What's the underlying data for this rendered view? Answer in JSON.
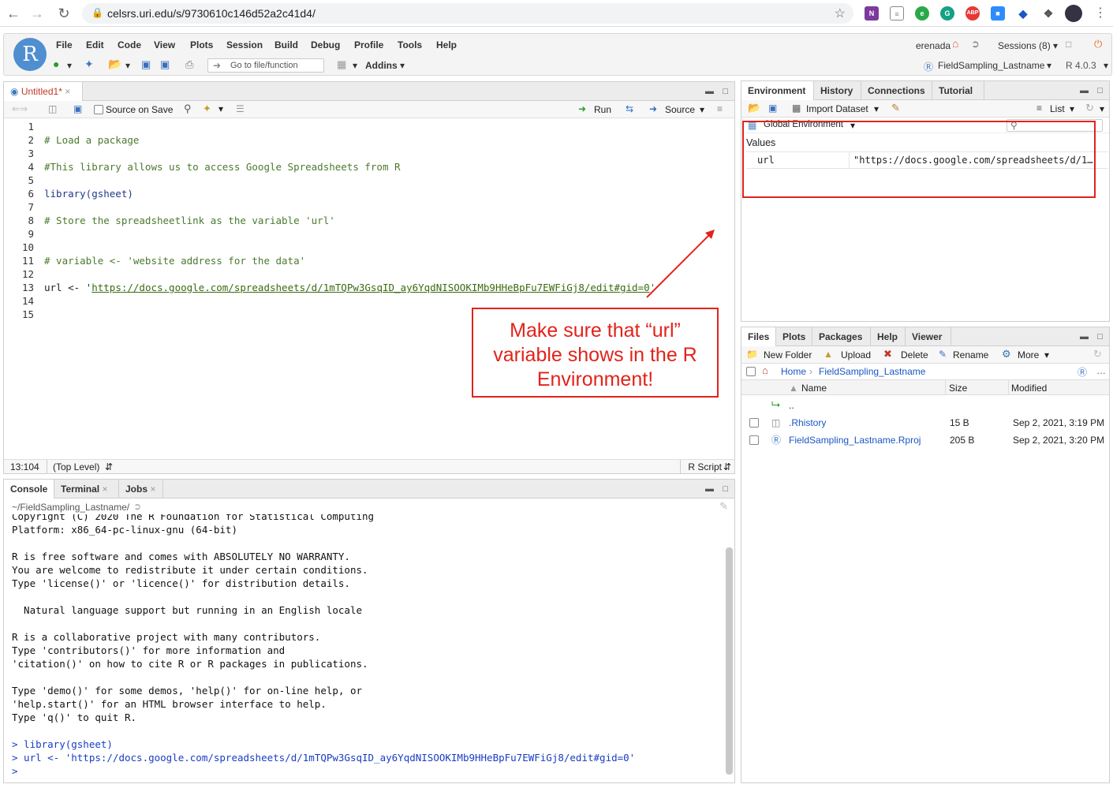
{
  "browser": {
    "url": "celsrs.uri.edu/s/9730610c146d52a2c41d4/",
    "extensions": [
      "onenote-icon",
      "doc-icon",
      "evernote-icon",
      "grammarly-icon",
      "adblock-icon",
      "zoom-icon",
      "graduation-icon",
      "puzzle-icon",
      "profile-icon"
    ]
  },
  "menu": {
    "items": [
      "File",
      "Edit",
      "Code",
      "View",
      "Plots",
      "Session",
      "Build",
      "Debug",
      "Profile",
      "Tools",
      "Help"
    ],
    "go_to_placeholder": "Go to file/function",
    "addins": "Addins",
    "user": "erenada",
    "sessions": "Sessions (8)",
    "project": "FieldSampling_Lastname",
    "r_version": "R 4.0.3"
  },
  "editor": {
    "tab": "Untitled1*",
    "source_on_save": "Source on Save",
    "run": "Run",
    "source": "Source",
    "lines": [
      {
        "n": "1",
        "t": "",
        "cls": ""
      },
      {
        "n": "2",
        "t": "# Load a package",
        "cls": "cmt"
      },
      {
        "n": "3",
        "t": "",
        "cls": ""
      },
      {
        "n": "4",
        "t": "#This library allows us to access Google Spreadsheets from R",
        "cls": "cmt"
      },
      {
        "n": "5",
        "t": "",
        "cls": ""
      },
      {
        "n": "6",
        "t": "library(gsheet)",
        "cls": "fn"
      },
      {
        "n": "7",
        "t": "",
        "cls": ""
      },
      {
        "n": "8",
        "t": "# Store the spreadsheetlink as the variable 'url'",
        "cls": "cmt"
      },
      {
        "n": "9",
        "t": "",
        "cls": ""
      },
      {
        "n": "10",
        "t": "",
        "cls": ""
      },
      {
        "n": "11",
        "t": "# variable <- 'website address for the data'",
        "cls": "cmt"
      },
      {
        "n": "12",
        "t": "",
        "cls": ""
      },
      {
        "n": "13",
        "t": "url <- 'https://docs.google.com/spreadsheets/d/1mTQPw3GsqID_ay6YqdNISOOKIMb9HHeBpFu7EWFiGj8/edit#gid=0'",
        "cls": "url"
      },
      {
        "n": "14",
        "t": "",
        "cls": ""
      },
      {
        "n": "15",
        "t": "",
        "cls": ""
      }
    ],
    "url_prefix": "url <- '",
    "url_link": "https://docs.google.com/spreadsheets/d/1mTQPw3GsqID_ay6YqdNISOOKIMb9HHeBpFu7EWFiGj8/edit#gid=0",
    "url_suffix": "'",
    "status_pos": "13:104",
    "status_scope": "(Top Level)",
    "status_type": "R Script"
  },
  "annotation": {
    "line1": "Make sure that “url”",
    "line2": "variable shows in the R",
    "line3": "Environment!"
  },
  "console": {
    "tabs": [
      "Console",
      "Terminal",
      "Jobs"
    ],
    "path": "~/FieldSampling_Lastname/",
    "lines": [
      "Copyright (C) 2020 The R Foundation for Statistical Computing",
      "Platform: x86_64-pc-linux-gnu (64-bit)",
      "",
      "R is free software and comes with ABSOLUTELY NO WARRANTY.",
      "You are welcome to redistribute it under certain conditions.",
      "Type 'license()' or 'licence()' for distribution details.",
      "",
      "  Natural language support but running in an English locale",
      "",
      "R is a collaborative project with many contributors.",
      "Type 'contributors()' for more information and",
      "'citation()' on how to cite R or R packages in publications.",
      "",
      "Type 'demo()' for some demos, 'help()' for on-line help, or",
      "'help.start()' for an HTML browser interface to help.",
      "Type 'q()' to quit R.",
      ""
    ],
    "cmd1": "> library(gsheet)",
    "cmd2": "> url <- 'https://docs.google.com/spreadsheets/d/1mTQPw3GsqID_ay6YqdNISOOKIMb9HHeBpFu7EWFiGj8/edit#gid=0'",
    "prompt": "> "
  },
  "environment": {
    "tabs": [
      "Environment",
      "History",
      "Connections",
      "Tutorial"
    ],
    "import_dataset": "Import Dataset",
    "list": "List",
    "global_env": "Global Environment",
    "values_header": "Values",
    "var_name": "url",
    "var_value": "\"https://docs.google.com/spreadsheets/d/1…"
  },
  "files": {
    "tabs": [
      "Files",
      "Plots",
      "Packages",
      "Help",
      "Viewer"
    ],
    "new_folder": "New Folder",
    "upload": "Upload",
    "delete": "Delete",
    "rename": "Rename",
    "more": "More",
    "crumb_home": "Home",
    "crumb_project": "FieldSampling_Lastname",
    "col_name": "Name",
    "col_size": "Size",
    "col_modified": "Modified",
    "up": "..",
    "rows": [
      {
        "name": ".Rhistory",
        "size": "15 B",
        "modified": "Sep 2, 2021, 3:19 PM"
      },
      {
        "name": "FieldSampling_Lastname.Rproj",
        "size": "205 B",
        "modified": "Sep 2, 2021, 3:20 PM"
      }
    ]
  },
  "colors": {
    "annotation_red": "#e2231a",
    "rstudio_blue": "#4f8fcf"
  }
}
